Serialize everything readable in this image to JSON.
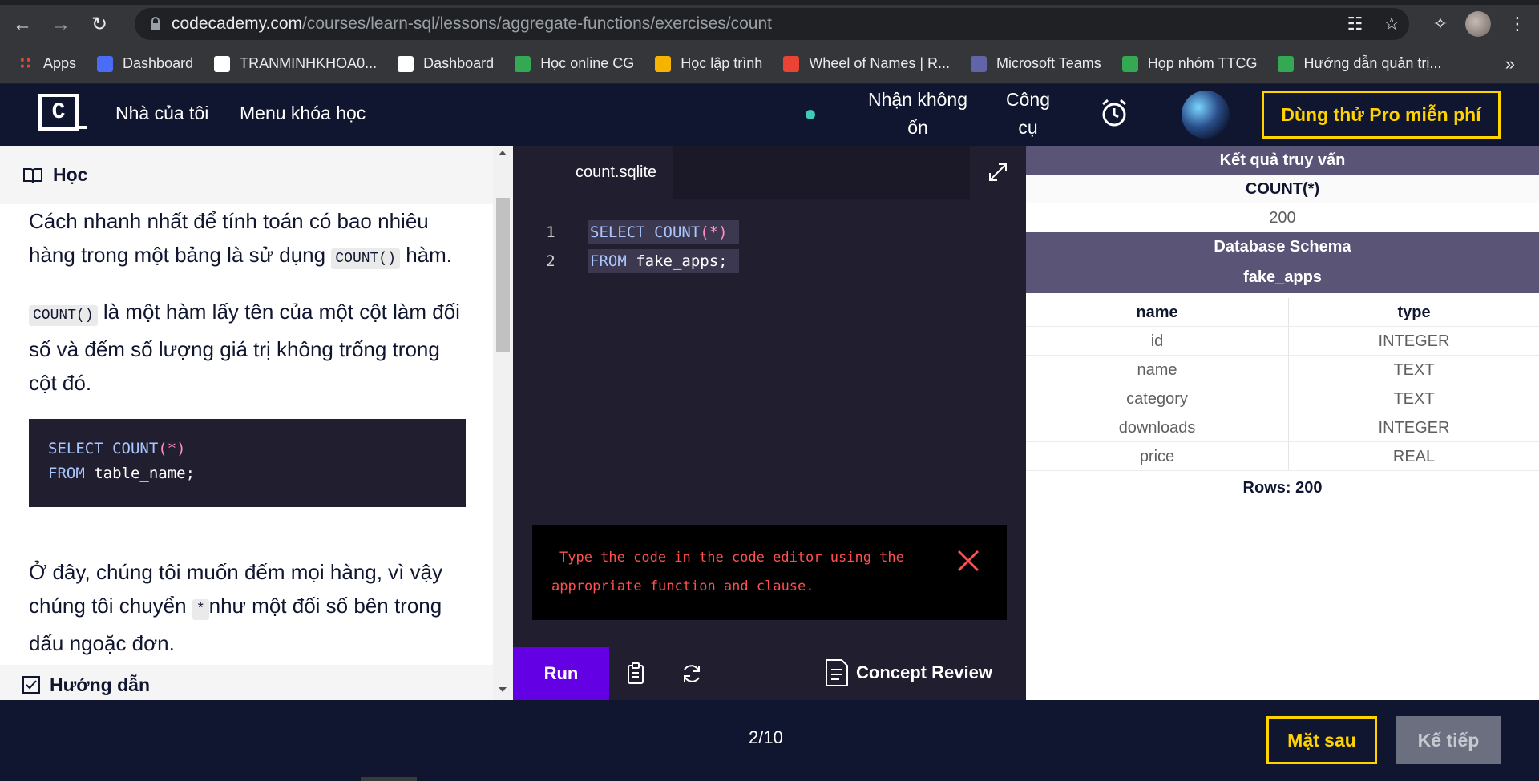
{
  "browser": {
    "url_host": "codecademy.com",
    "url_path": "/courses/learn-sql/lessons/aggregate-functions/exercises/count",
    "bookmarks": [
      {
        "label": "Apps",
        "color": "#ea4335"
      },
      {
        "label": "Dashboard",
        "color": "#4a6cf7"
      },
      {
        "label": "TRANMINHKHOA0...",
        "color": "#ffffff"
      },
      {
        "label": "Dashboard",
        "color": "#ffffff"
      },
      {
        "label": "Học online CG",
        "color": "#34a853"
      },
      {
        "label": "Học lập trình",
        "color": "#f4b400"
      },
      {
        "label": "Wheel of Names | R...",
        "color": "#ea4335"
      },
      {
        "label": "Microsoft Teams",
        "color": "#6264a7"
      },
      {
        "label": "Họp nhóm TTCG",
        "color": "#34a853"
      },
      {
        "label": "Hướng dẫn quản trị...",
        "color": "#34a853"
      }
    ]
  },
  "header": {
    "logo": "C",
    "nav_home": "Nhà của tôi",
    "nav_menu": "Menu khóa học",
    "unstable_line1": "Nhận không",
    "unstable_line2": "ổn",
    "tools_line1": "Công",
    "tools_line2": "cụ",
    "pro_button": "Dùng thử Pro miễn phí"
  },
  "learn": {
    "title": "Học",
    "p1_a": "Cách nhanh nhất để tính toán có bao nhiêu hàng trong một bảng là sử dụng ",
    "p1_code": "COUNT()",
    "p1_b": " hàm.",
    "p2_code": "COUNT()",
    "p2_b": " là một hàm lấy tên của một cột làm đối số và đếm số lượng giá trị không trống trong cột đó.",
    "code_line1_kw": "SELECT",
    "code_line1_fn": "COUNT",
    "code_line1_args": "(*)",
    "code_line2_kw": "FROM",
    "code_line2_rest": "table_name;",
    "p3_a": "Ở đây, chúng tôi muốn đếm mọi hàng, vì vậy chúng tôi chuyển ",
    "p3_code": "*",
    "p3_b": "như một đối số bên trong dấu ngoặc đơn.",
    "guide_title": "Hướng dẫn"
  },
  "editor": {
    "tab": "count.sqlite",
    "lines": [
      {
        "num": "1",
        "kw": "SELECT",
        "fn": "COUNT",
        "rest": "(*)"
      },
      {
        "num": "2",
        "kw": "FROM",
        "fn": "",
        "rest": "fake_apps;"
      }
    ],
    "error_line1": "Type the code in the code editor using the",
    "error_line2": "appropriate function and clause.",
    "run": "Run",
    "concept_review": "Concept Review"
  },
  "results": {
    "query_title": "Kết quả truy vấn",
    "column": "COUNT(*)",
    "value": "200",
    "schema_title": "Database Schema",
    "table_name": "fake_apps",
    "schema_headers": [
      "name",
      "type"
    ],
    "schema_rows": [
      [
        "id",
        "INTEGER"
      ],
      [
        "name",
        "TEXT"
      ],
      [
        "category",
        "TEXT"
      ],
      [
        "downloads",
        "INTEGER"
      ],
      [
        "price",
        "REAL"
      ]
    ],
    "rows_label": "Rows: 200"
  },
  "footer": {
    "progress": "2/10",
    "back": "Mặt sau",
    "next": "Kế tiếp"
  }
}
